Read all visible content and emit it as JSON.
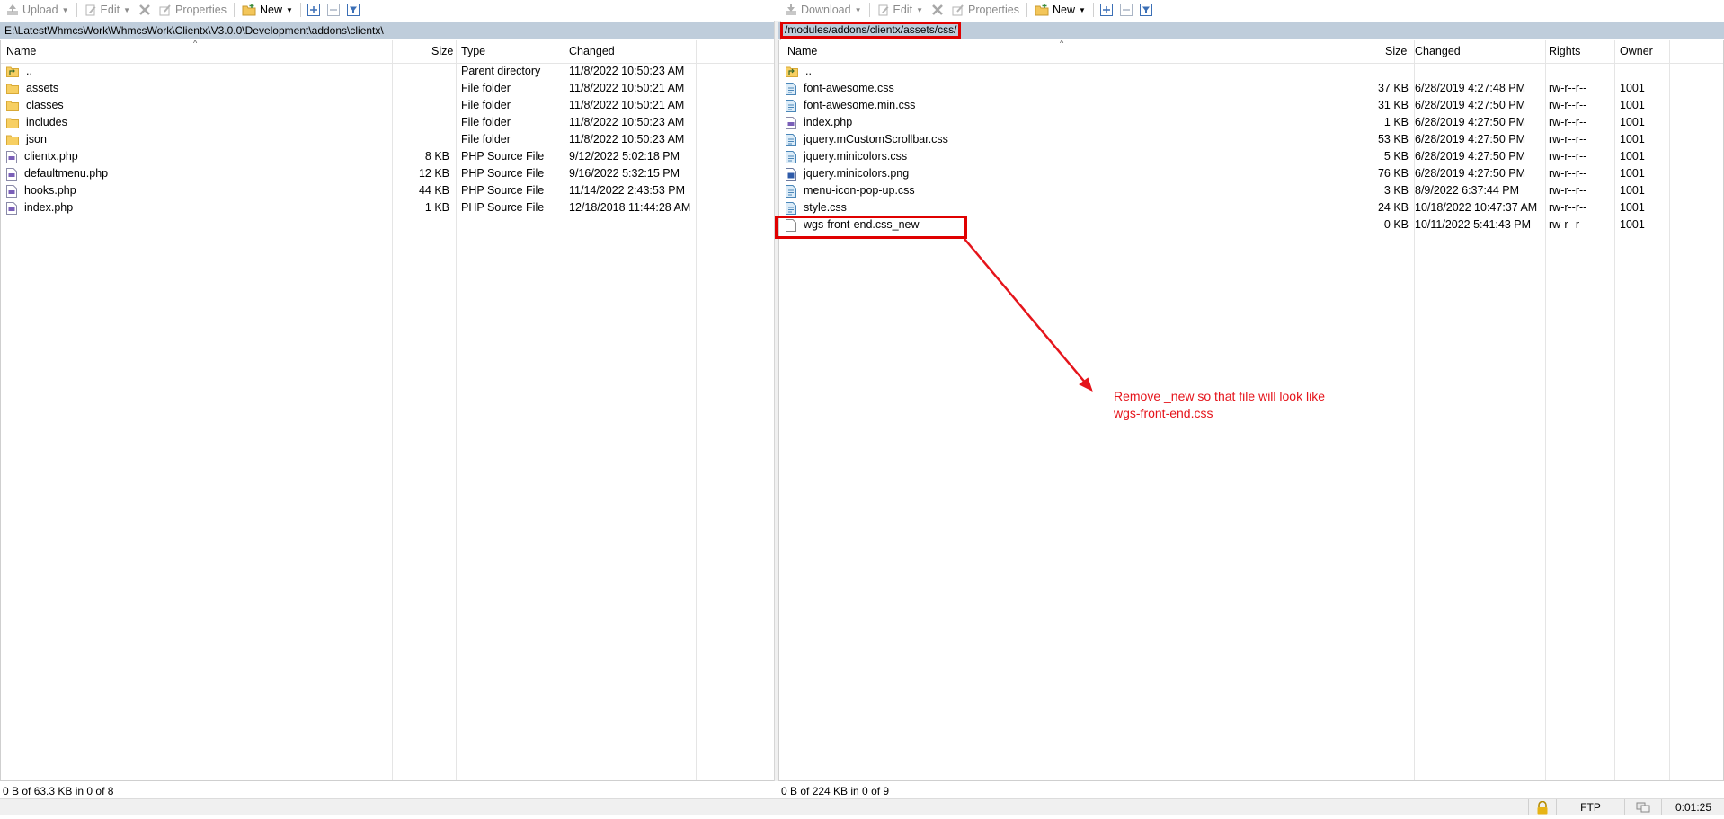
{
  "left": {
    "toolbar": {
      "upload_label": "Upload",
      "edit_label": "Edit",
      "properties_label": "Properties",
      "new_label": "New"
    },
    "path": "E:\\LatestWhmcsWork\\WhmcsWork\\Clientx\\V3.0.0\\Development\\addons\\clientx\\",
    "columns": {
      "name": "Name",
      "size": "Size",
      "type": "Type",
      "changed": "Changed"
    },
    "rows": [
      {
        "name": "..",
        "size": "",
        "type": "Parent directory",
        "changed": "11/8/2022  10:50:23 AM",
        "icon": "parent-folder-icon"
      },
      {
        "name": "assets",
        "size": "",
        "type": "File folder",
        "changed": "11/8/2022  10:50:21 AM",
        "icon": "folder-icon"
      },
      {
        "name": "classes",
        "size": "",
        "type": "File folder",
        "changed": "11/8/2022  10:50:21 AM",
        "icon": "folder-icon"
      },
      {
        "name": "includes",
        "size": "",
        "type": "File folder",
        "changed": "11/8/2022  10:50:23 AM",
        "icon": "folder-icon"
      },
      {
        "name": "json",
        "size": "",
        "type": "File folder",
        "changed": "11/8/2022  10:50:23 AM",
        "icon": "folder-icon"
      },
      {
        "name": "clientx.php",
        "size": "8 KB",
        "type": "PHP Source File",
        "changed": "9/12/2022  5:02:18 PM",
        "icon": "php-file-icon"
      },
      {
        "name": "defaultmenu.php",
        "size": "12 KB",
        "type": "PHP Source File",
        "changed": "9/16/2022  5:32:15 PM",
        "icon": "php-file-icon"
      },
      {
        "name": "hooks.php",
        "size": "44 KB",
        "type": "PHP Source File",
        "changed": "11/14/2022  2:43:53 PM",
        "icon": "php-file-icon"
      },
      {
        "name": "index.php",
        "size": "1 KB",
        "type": "PHP Source File",
        "changed": "12/18/2018  11:44:28 AM",
        "icon": "php-file-icon"
      }
    ],
    "status": "0 B of 63.3 KB in 0 of 8"
  },
  "right": {
    "toolbar": {
      "download_label": "Download",
      "edit_label": "Edit",
      "properties_label": "Properties",
      "new_label": "New"
    },
    "path": "/modules/addons/clientx/assets/css/",
    "columns": {
      "name": "Name",
      "size": "Size",
      "changed": "Changed",
      "rights": "Rights",
      "owner": "Owner"
    },
    "rows": [
      {
        "name": "..",
        "size": "",
        "changed": "",
        "rights": "",
        "owner": "",
        "icon": "parent-folder-icon"
      },
      {
        "name": "font-awesome.css",
        "size": "37 KB",
        "changed": "6/28/2019 4:27:48 PM",
        "rights": "rw-r--r--",
        "owner": "1001",
        "icon": "css-file-icon"
      },
      {
        "name": "font-awesome.min.css",
        "size": "31 KB",
        "changed": "6/28/2019 4:27:50 PM",
        "rights": "rw-r--r--",
        "owner": "1001",
        "icon": "css-file-icon"
      },
      {
        "name": "index.php",
        "size": "1 KB",
        "changed": "6/28/2019 4:27:50 PM",
        "rights": "rw-r--r--",
        "owner": "1001",
        "icon": "php-file-icon"
      },
      {
        "name": "jquery.mCustomScrollbar.css",
        "size": "53 KB",
        "changed": "6/28/2019 4:27:50 PM",
        "rights": "rw-r--r--",
        "owner": "1001",
        "icon": "css-file-icon"
      },
      {
        "name": "jquery.minicolors.css",
        "size": "5 KB",
        "changed": "6/28/2019 4:27:50 PM",
        "rights": "rw-r--r--",
        "owner": "1001",
        "icon": "css-file-icon"
      },
      {
        "name": "jquery.minicolors.png",
        "size": "76 KB",
        "changed": "6/28/2019 4:27:50 PM",
        "rights": "rw-r--r--",
        "owner": "1001",
        "icon": "image-file-icon"
      },
      {
        "name": "menu-icon-pop-up.css",
        "size": "3 KB",
        "changed": "8/9/2022 6:37:44 PM",
        "rights": "rw-r--r--",
        "owner": "1001",
        "icon": "css-file-icon"
      },
      {
        "name": "style.css",
        "size": "24 KB",
        "changed": "10/18/2022 10:47:37 AM",
        "rights": "rw-r--r--",
        "owner": "1001",
        "icon": "css-file-icon"
      },
      {
        "name": "wgs-front-end.css_new",
        "size": "0 KB",
        "changed": "10/11/2022 5:41:43 PM",
        "rights": "rw-r--r--",
        "owner": "1001",
        "icon": "blank-file-icon"
      }
    ],
    "status": "0 B of 224 KB in 0 of 9"
  },
  "annotation": {
    "line1": "Remove _new so that file will look like",
    "line2": "wgs-front-end.css",
    "color": "#e5141b"
  },
  "bottom_bar": {
    "protocol": "FTP",
    "timer": "0:01:25"
  }
}
